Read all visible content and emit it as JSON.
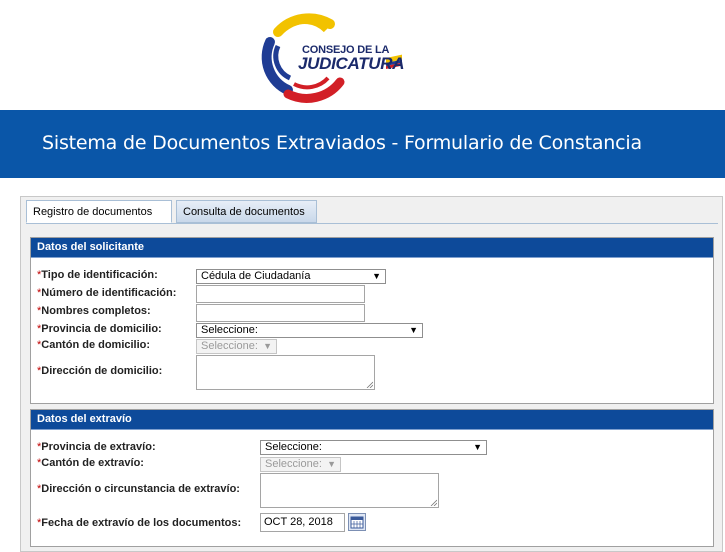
{
  "logo": {
    "line1": "CONSEJO DE LA",
    "line2": "JUDICATURA"
  },
  "banner": {
    "title": "Sistema de Documentos Extraviados - Formulario de Constancia"
  },
  "tabs": [
    {
      "label": "Registro de documentos"
    },
    {
      "label": "Consulta de documentos"
    }
  ],
  "solicitante": {
    "header": "Datos del solicitante",
    "tipo_label": "Tipo de identificación:",
    "tipo_value": "Cédula de Ciudadanía",
    "numero_label": "Número de identificación:",
    "nombres_label": "Nombres completos:",
    "provincia_label": "Provincia de domicilio:",
    "provincia_value": "Seleccione:",
    "canton_label": "Cantón de domicilio:",
    "canton_value": "Seleccione:",
    "direccion_label": "Dirección de domicilio:"
  },
  "extravio": {
    "header": "Datos del extravío",
    "provincia_label": "Provincia de extravío:",
    "provincia_value": "Seleccione:",
    "canton_label": "Cantón de extravío:",
    "canton_value": "Seleccione:",
    "direccion_label": "Dirección o circunstancia de extravío:",
    "fecha_label": "Fecha de extravío de los documentos:",
    "fecha_value": "OCT 28, 2018"
  },
  "required_mark": "*",
  "colors": {
    "banner": "#0a56a8",
    "section_header": "#0d4a9a",
    "required": "#c00000"
  }
}
